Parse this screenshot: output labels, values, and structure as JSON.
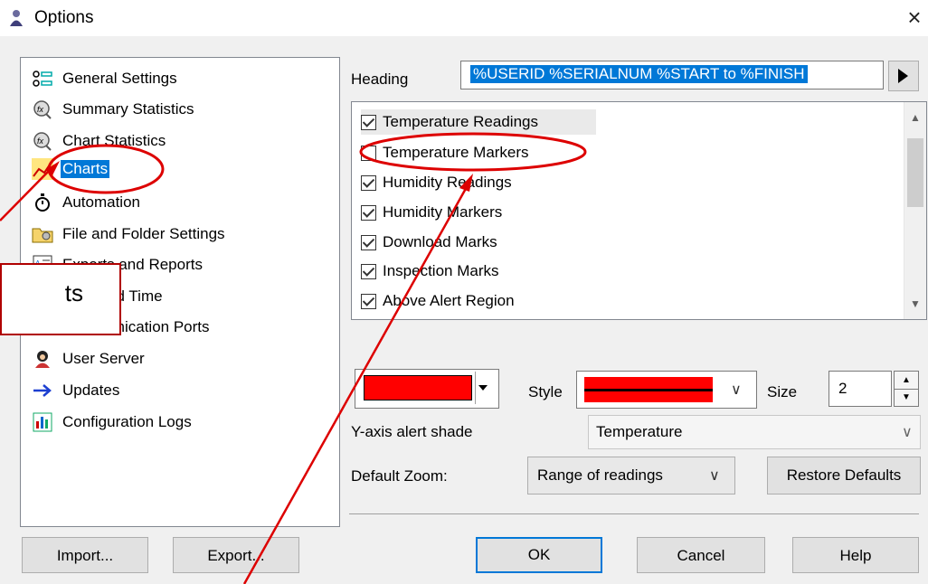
{
  "window": {
    "title": "Options",
    "close_glyph": "×"
  },
  "sidebar": {
    "items": [
      {
        "label": "General Settings",
        "icon": "settings-icon"
      },
      {
        "label": "Summary Statistics",
        "icon": "fx-icon"
      },
      {
        "label": "Chart Statistics",
        "icon": "fx-icon"
      },
      {
        "label": "Charts",
        "icon": "chart-icon",
        "selected": true
      },
      {
        "label": "Automation",
        "icon": "stopwatch-icon"
      },
      {
        "label": "File and Folder Settings",
        "icon": "folder-icon"
      },
      {
        "label": "Exports and Reports",
        "icon": "report-icon"
      },
      {
        "label": "Date and Time",
        "icon": "calendar-icon"
      },
      {
        "label": "Communication Ports",
        "icon": "port-icon"
      },
      {
        "label": "User Server",
        "icon": "user-server-icon"
      },
      {
        "label": "Updates",
        "icon": "arrow-right-icon"
      },
      {
        "label": "Configuration Logs",
        "icon": "log-icon"
      }
    ]
  },
  "heading": {
    "label": "Heading",
    "value": "%USERID %SERIALNUM %START to %FINISH"
  },
  "series_list": {
    "items": [
      {
        "label": "Temperature Readings",
        "checked": true
      },
      {
        "label": "Temperature Markers",
        "checked": false
      },
      {
        "label": "Humidity Readings",
        "checked": true
      },
      {
        "label": "Humidity Markers",
        "checked": true
      },
      {
        "label": "Download Marks",
        "checked": true
      },
      {
        "label": "Inspection Marks",
        "checked": true
      },
      {
        "label": "Above Alert Region",
        "checked": true
      }
    ]
  },
  "style_row": {
    "color": "#ff0000",
    "style_label": "Style",
    "size_label": "Size",
    "size_value": "2"
  },
  "y_axis": {
    "label": "Y-axis alert shade",
    "value": "Temperature"
  },
  "zoom": {
    "label": "Default Zoom:",
    "value": "Range of readings"
  },
  "restore_label": "Restore Defaults",
  "buttons": {
    "import": "Import...",
    "export": "Export...",
    "ok": "OK",
    "cancel": "Cancel",
    "help": "Help"
  },
  "annotation": {
    "callout_text": "ts",
    "color": "#b00000"
  }
}
